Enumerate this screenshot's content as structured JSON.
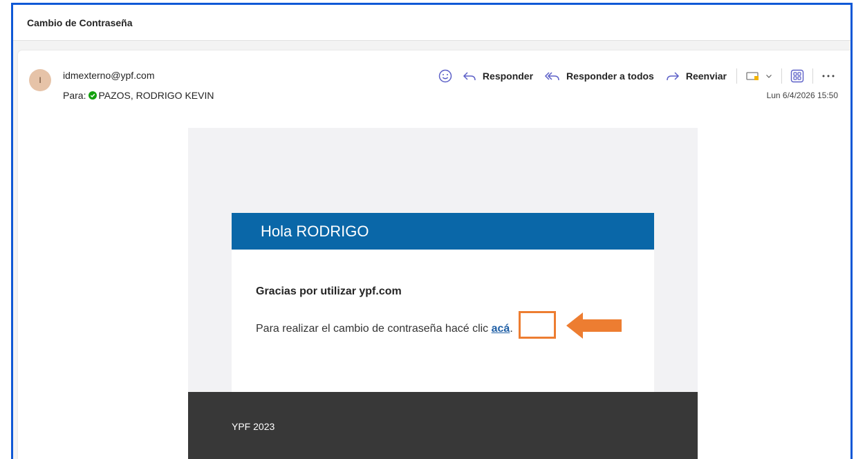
{
  "subject": "Cambio de Contraseña",
  "sender": {
    "initial": "I",
    "email": "idmexterno@ypf.com",
    "to_label": "Para:",
    "to_name": "PAZOS, RODRIGO KEVIN",
    "date": "Lun 6/4/2026 15:50"
  },
  "actions": {
    "reply": "Responder",
    "reply_all": "Responder a todos",
    "forward": "Reenviar"
  },
  "icons": [
    "smiley-icon",
    "reply-icon",
    "reply-all-icon",
    "forward-icon",
    "tag-icon",
    "chevron-down-icon",
    "apps-icon",
    "more-icon",
    "check-icon",
    "arrow-left-icon"
  ],
  "email": {
    "greeting": "Hola RODRIGO",
    "thanks": "Gracias por utilizar ypf.com",
    "instruction": "Para realizar el cambio de contraseña hacé clic ",
    "link_text": "acá",
    "link_suffix": ".",
    "footer": "YPF 2023"
  },
  "colors": {
    "frame_border": "#0f58d6",
    "header_blue": "#0a67a8",
    "action_purple": "#5b5fc7",
    "highlight_orange": "#ed7d31",
    "footer_dark": "#383838"
  }
}
